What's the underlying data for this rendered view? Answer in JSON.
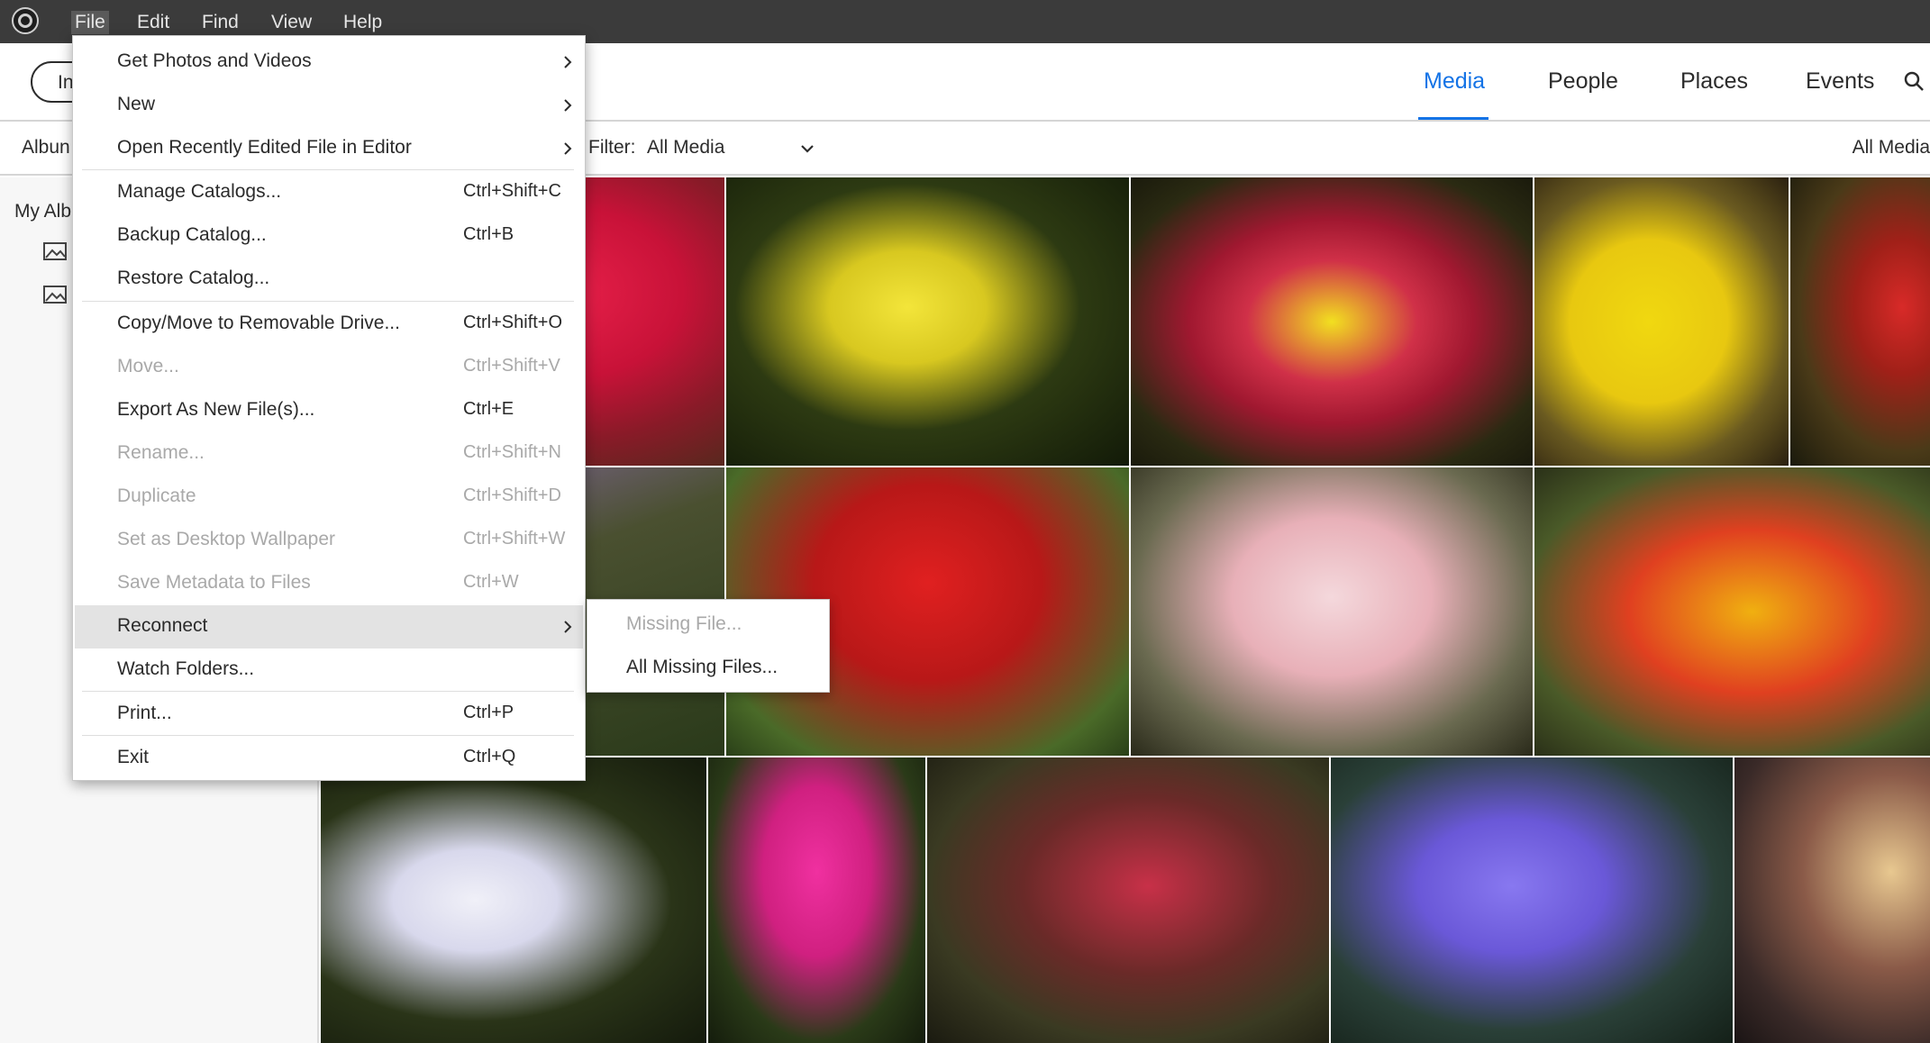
{
  "menubar": {
    "items": [
      "File",
      "Edit",
      "Find",
      "View",
      "Help"
    ]
  },
  "header": {
    "import_label": "In",
    "tabs": [
      "Media",
      "People",
      "Places",
      "Events"
    ],
    "active_tab": "Media"
  },
  "filterbar": {
    "albums_label": "Albun",
    "filter_label": "Filter:",
    "filter_value": "All Media",
    "right_label": "All Media"
  },
  "leftpanel": {
    "my_albums": "My Alb"
  },
  "file_menu": {
    "items": [
      {
        "label": "Get Photos and Videos",
        "shortcut": "",
        "submenu": true,
        "enabled": true
      },
      {
        "label": "New",
        "shortcut": "",
        "submenu": true,
        "enabled": true
      },
      {
        "label": "Open Recently Edited File in Editor",
        "shortcut": "",
        "submenu": true,
        "enabled": true
      },
      {
        "label": "Manage Catalogs...",
        "shortcut": "Ctrl+Shift+C",
        "submenu": false,
        "enabled": true
      },
      {
        "label": "Backup Catalog...",
        "shortcut": "Ctrl+B",
        "submenu": false,
        "enabled": true
      },
      {
        "label": "Restore Catalog...",
        "shortcut": "",
        "submenu": false,
        "enabled": true
      },
      {
        "label": "Copy/Move to Removable Drive...",
        "shortcut": "Ctrl+Shift+O",
        "submenu": false,
        "enabled": true
      },
      {
        "label": "Move...",
        "shortcut": "Ctrl+Shift+V",
        "submenu": false,
        "enabled": false
      },
      {
        "label": "Export As New File(s)...",
        "shortcut": "Ctrl+E",
        "submenu": false,
        "enabled": true
      },
      {
        "label": "Rename...",
        "shortcut": "Ctrl+Shift+N",
        "submenu": false,
        "enabled": false
      },
      {
        "label": "Duplicate",
        "shortcut": "Ctrl+Shift+D",
        "submenu": false,
        "enabled": false
      },
      {
        "label": "Set as Desktop Wallpaper",
        "shortcut": "Ctrl+Shift+W",
        "submenu": false,
        "enabled": false
      },
      {
        "label": "Save Metadata to Files",
        "shortcut": "Ctrl+W",
        "submenu": false,
        "enabled": false
      },
      {
        "label": "Reconnect",
        "shortcut": "",
        "submenu": true,
        "enabled": true
      },
      {
        "label": "Watch Folders...",
        "shortcut": "",
        "submenu": false,
        "enabled": true
      },
      {
        "label": "Print...",
        "shortcut": "Ctrl+P",
        "submenu": false,
        "enabled": true
      },
      {
        "label": "Exit",
        "shortcut": "Ctrl+Q",
        "submenu": false,
        "enabled": true
      }
    ]
  },
  "reconnect_submenu": {
    "items": [
      {
        "label": "Missing File...",
        "enabled": false
      },
      {
        "label": "All Missing Files...",
        "enabled": true
      }
    ]
  },
  "colors": {
    "accent": "#1473e6",
    "menubar_bg": "#3b3b3b",
    "disabled_text": "#a9a9a9"
  }
}
